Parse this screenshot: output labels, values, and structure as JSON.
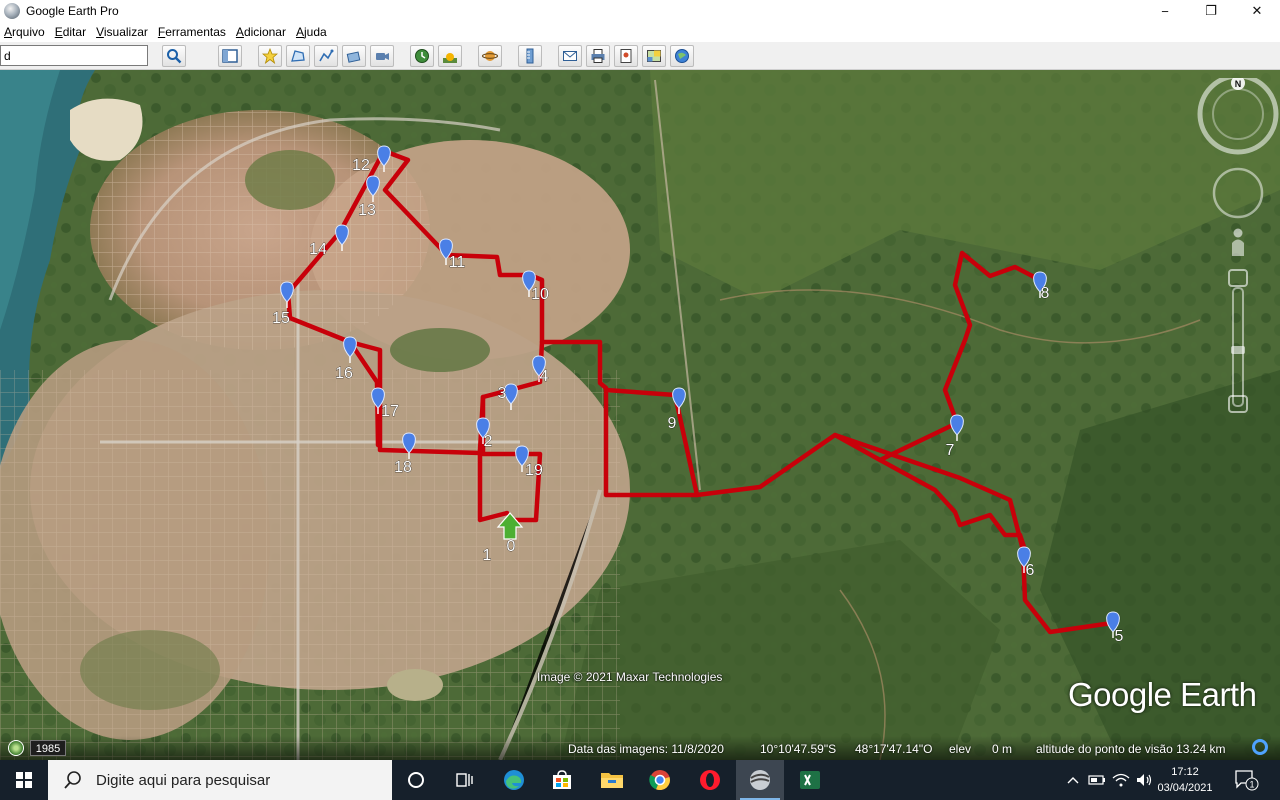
{
  "window": {
    "title": "Google Earth Pro",
    "minimize": "−",
    "restore": "❐",
    "close": "✕"
  },
  "menu": [
    {
      "first": "A",
      "rest": "rquivo"
    },
    {
      "first": "E",
      "rest": "ditar"
    },
    {
      "first": "V",
      "rest": "isualizar"
    },
    {
      "first": "F",
      "rest": "erramentas"
    },
    {
      "first": "A",
      "rest": "dicionar"
    },
    {
      "first": "A",
      "rest": "juda"
    }
  ],
  "search": {
    "value": "d"
  },
  "toolbar_icons": [
    "search-icon",
    "sidebar-icon",
    "placemark-icon",
    "polygon-icon",
    "path-icon",
    "overlay-icon",
    "tour-icon",
    "history-icon",
    "sun-icon",
    "planet-icon",
    "ruler-icon",
    "email-icon",
    "print-icon",
    "save-image-icon",
    "map-view-icon",
    "maps-icon"
  ],
  "map": {
    "attribution": "Image © 2021 Maxar Technologies",
    "logo": "Google Earth",
    "route_color": "#c8000a",
    "placemarks": [
      {
        "label": "0"
      },
      {
        "label": "1"
      },
      {
        "label": "2"
      },
      {
        "label": "3"
      },
      {
        "label": "4"
      },
      {
        "label": "5"
      },
      {
        "label": "6"
      },
      {
        "label": "7"
      },
      {
        "label": "8"
      },
      {
        "label": "9"
      },
      {
        "label": "10"
      },
      {
        "label": "11"
      },
      {
        "label": "12"
      },
      {
        "label": "13"
      },
      {
        "label": "14"
      },
      {
        "label": "15"
      },
      {
        "label": "16"
      },
      {
        "label": "17"
      },
      {
        "label": "18"
      },
      {
        "label": "19"
      }
    ],
    "compass_label": "N"
  },
  "status": {
    "year": "1985",
    "imagery_date": "Data das imagens: 11/8/2020",
    "lat": "10°10'47.59\"S",
    "lon": "48°17'47.14\"O",
    "elev_label": "elev",
    "elev_value": "0 m",
    "eye_alt": "altitude do ponto de visão  13.24 km"
  },
  "taskbar": {
    "search_placeholder": "Digite aqui para pesquisar",
    "apps": [
      "cortana-icon",
      "task-view-icon",
      "edge-icon",
      "store-icon",
      "file-explorer-icon",
      "chrome-icon",
      "opera-icon",
      "google-earth-icon",
      "excel-icon"
    ],
    "time": "17:12",
    "date": "03/04/2021",
    "notification_count": "1"
  }
}
